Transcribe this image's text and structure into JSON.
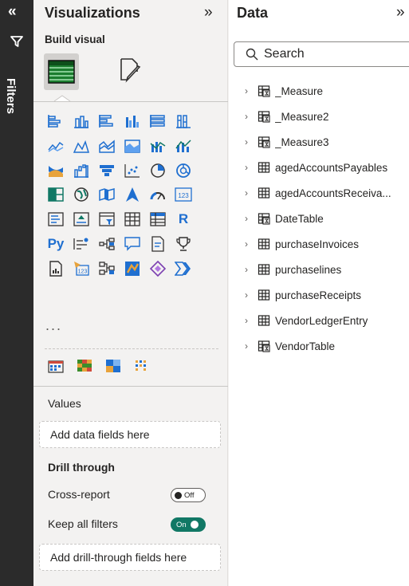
{
  "filters_rail": {
    "collapse_glyph": "«",
    "label": "Filters"
  },
  "visualizations": {
    "title": "Visualizations",
    "expand_glyph": "»",
    "build_visual": "Build visual",
    "more": "...",
    "values_label": "Values",
    "values_placeholder": "Add data fields here",
    "drill_title": "Drill through",
    "cross_report_label": "Cross-report",
    "cross_report_state": "Off",
    "keep_filters_label": "Keep all filters",
    "keep_filters_state": "On",
    "drill_placeholder": "Add drill-through fields here",
    "r_text": "R",
    "py_text": "Py",
    "card_text": "123"
  },
  "data_pane": {
    "title": "Data",
    "expand_glyph": "»",
    "search_placeholder": "Search",
    "items": [
      {
        "name": "_Measure",
        "icon": "measure-table-icon"
      },
      {
        "name": "_Measure2",
        "icon": "measure-table-icon"
      },
      {
        "name": "_Measure3",
        "icon": "measure-table-icon"
      },
      {
        "name": "agedAccountsPayables",
        "icon": "table-icon"
      },
      {
        "name": "agedAccountsReceiva...",
        "icon": "table-icon"
      },
      {
        "name": "DateTable",
        "icon": "measure-table-icon"
      },
      {
        "name": "purchaseInvoices",
        "icon": "table-icon"
      },
      {
        "name": "purchaselines",
        "icon": "table-icon"
      },
      {
        "name": "purchaseReceipts",
        "icon": "table-icon"
      },
      {
        "name": "VendorLedgerEntry",
        "icon": "table-icon"
      },
      {
        "name": "VendorTable",
        "icon": "measure-table-icon"
      }
    ]
  },
  "colors": {
    "accent": "#117865",
    "rail": "#2b2b2b",
    "pane": "#f3f2f1",
    "icon_blue": "#1f6fd0",
    "icon_green": "#117865"
  }
}
